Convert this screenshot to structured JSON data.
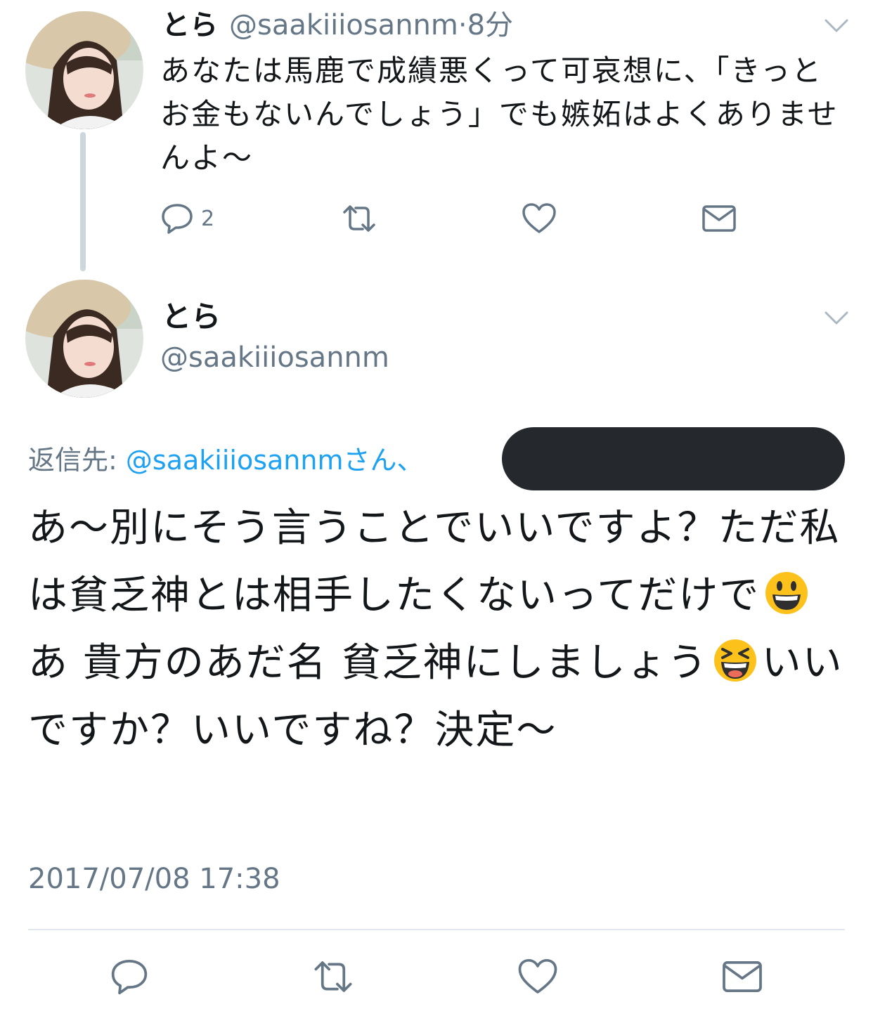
{
  "tweet1": {
    "name": "とら",
    "handle": "@saakiiiosannm",
    "separator": "·",
    "time": "8分",
    "text": "あなたは馬鹿で成績悪くって可哀想に、「きっとお金もないんでしょう」でも嫉妬はよくありませんよ〜",
    "reply_count": "2"
  },
  "tweet2": {
    "name": "とら",
    "handle": "@saakiiiosannm",
    "reply_to_label": "返信先: ",
    "reply_to_mention": "@saakiiiosannmさん、",
    "text_part1": "あ〜別にそう言うことでいいですよ？ただ私は貧乏神とは相手したくないってだけで",
    "text_part2": " あ 貴方のあだ名 貧乏神にしましょう",
    "text_part3": "いいですか？いいですね？決定〜",
    "timestamp": "2017/07/08 17:38"
  },
  "icons": {
    "reply": "reply-icon",
    "retweet": "retweet-icon",
    "like": "heart-icon",
    "dm": "mail-icon",
    "more": "chevron-down-icon",
    "emoji1": "grinning-face-emoji",
    "emoji2": "laughing-face-emoji"
  },
  "colors": {
    "text": "#14171a",
    "secondary": "#657786",
    "link": "#1da1f2",
    "thread_line": "#ccd6dd",
    "redaction": "#25292e"
  }
}
